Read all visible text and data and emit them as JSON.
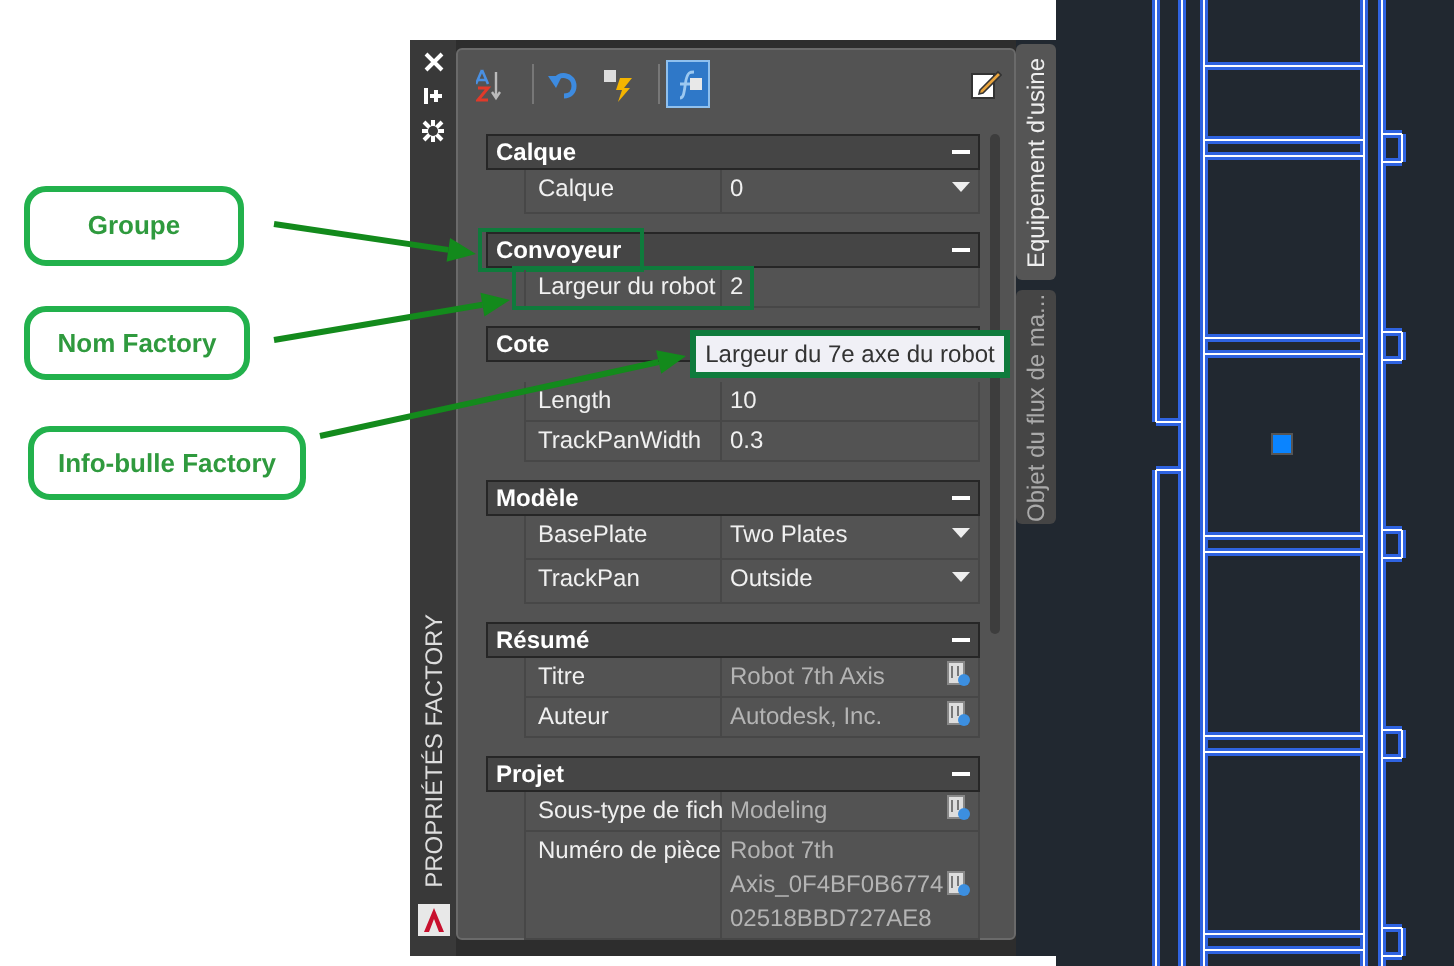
{
  "annotations": [
    {
      "label": "Groupe"
    },
    {
      "label": "Nom Factory"
    },
    {
      "label": "Info-bulle Factory"
    }
  ],
  "palette": {
    "title": "PROPRIÉTÉS FACTORY"
  },
  "toolbar": [
    {
      "kind": "sort",
      "selected": false
    },
    {
      "kind": "undo",
      "selected": false
    },
    {
      "kind": "quick",
      "selected": false
    },
    {
      "kind": "formula",
      "selected": true
    }
  ],
  "groups": [
    {
      "title": "Calque",
      "expanded": true,
      "highlighted": false,
      "rows": [
        {
          "label": "Calque",
          "value": "0",
          "kind": "dropdown",
          "highlighted": false
        }
      ]
    },
    {
      "title": "Convoyeur",
      "expanded": true,
      "highlighted": true,
      "rows": [
        {
          "label": "Largeur du robot",
          "value": "2",
          "kind": "text",
          "highlighted": true
        }
      ]
    },
    {
      "title": "Cote",
      "expanded": true,
      "highlighted": false,
      "rows": [
        {
          "label": "Length",
          "value": "10",
          "kind": "text",
          "highlighted": false
        },
        {
          "label": "TrackPanWidth",
          "value": "0.3",
          "kind": "text",
          "highlighted": false
        }
      ]
    },
    {
      "title": "Modèle",
      "expanded": true,
      "highlighted": false,
      "rows": [
        {
          "label": "BasePlate",
          "value": "Two Plates",
          "kind": "dropdown",
          "highlighted": false
        },
        {
          "label": "TrackPan",
          "value": "Outside",
          "kind": "dropdown",
          "highlighted": false
        }
      ]
    },
    {
      "title": "Résumé",
      "expanded": true,
      "highlighted": false,
      "rows": [
        {
          "label": "Titre",
          "value": "Robot 7th Axis",
          "kind": "readonly",
          "highlighted": false
        },
        {
          "label": "Auteur",
          "value": "Autodesk, Inc.",
          "kind": "readonly",
          "highlighted": false
        }
      ]
    },
    {
      "title": "Projet",
      "expanded": true,
      "highlighted": false,
      "rows": [
        {
          "label": "Sous-type de fich",
          "value": "Modeling",
          "kind": "readonly",
          "highlighted": false
        },
        {
          "label": "Numéro de pièce",
          "value": "Robot 7th\nAxis_0F4BF0B6774\n02518BBD727AE8",
          "kind": "readonly",
          "highlighted": false
        }
      ]
    }
  ],
  "tooltip": {
    "text": "Largeur du 7e axe du robot"
  },
  "side_tabs": [
    {
      "label": "Equipement d'usine",
      "selected": true
    },
    {
      "label": "Objet du flux de ma...",
      "selected": false
    }
  ]
}
